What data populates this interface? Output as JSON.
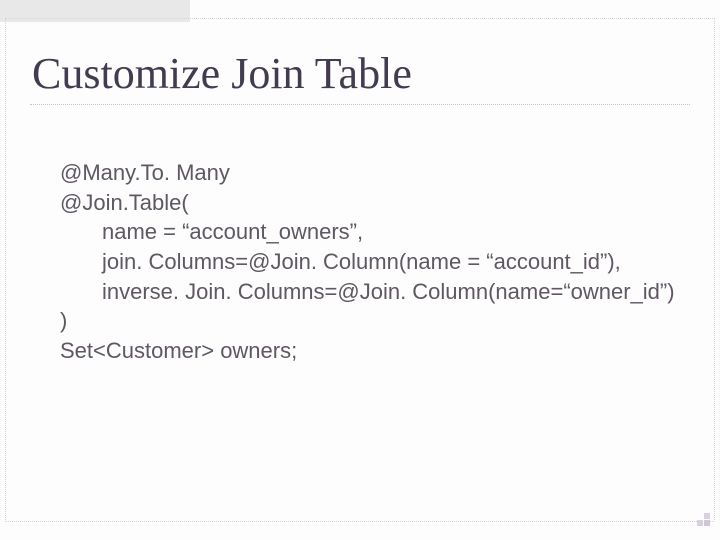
{
  "slide": {
    "title": "Customize Join Table",
    "code": {
      "l1": "@Many.To. Many",
      "l2": "@Join.Table(",
      "l3": "name = “account_owners”,",
      "l4": "join. Columns=@Join. Column(name = “account_id”),",
      "l5": "inverse. Join. Columns=@Join. Column(name=“owner_id”)",
      "l6": ")",
      "l7": "Set<Customer> owners;"
    }
  }
}
